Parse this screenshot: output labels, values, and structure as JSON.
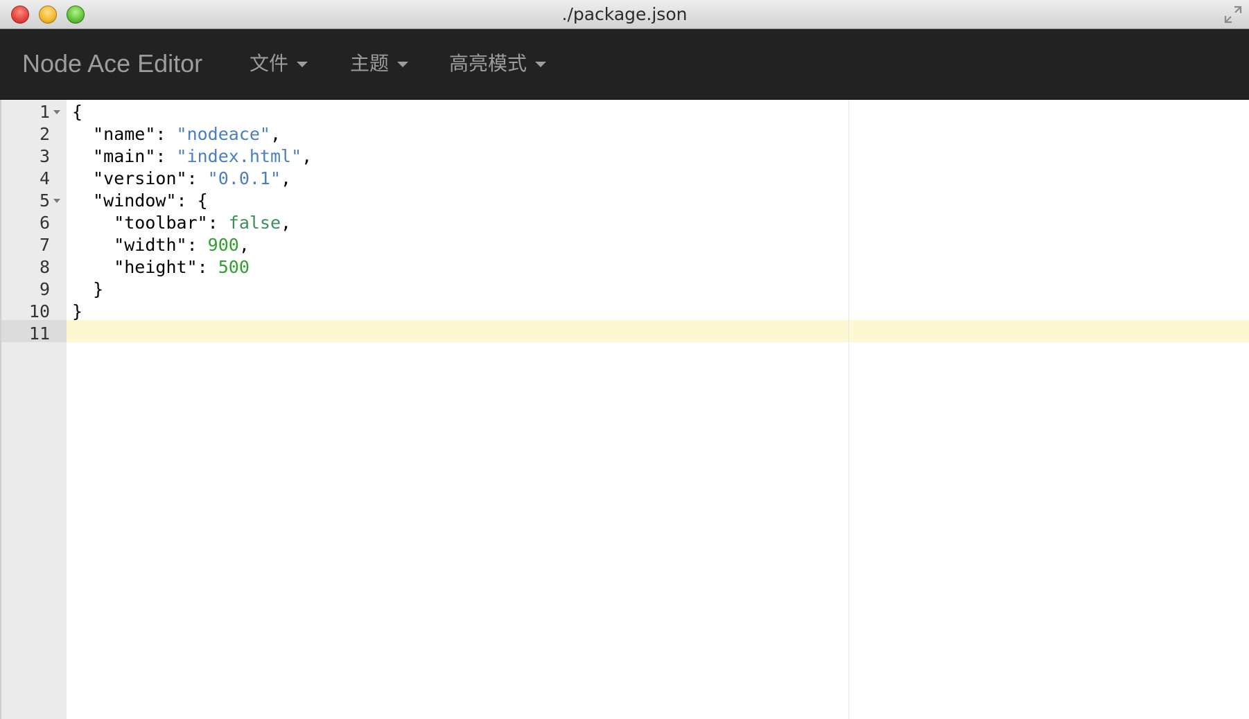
{
  "window": {
    "title": "./package.json"
  },
  "navbar": {
    "brand": "Node Ace Editor",
    "menus": [
      {
        "label": "文件"
      },
      {
        "label": "主题"
      },
      {
        "label": "高亮模式"
      }
    ]
  },
  "editor": {
    "active_line": 11,
    "lines": [
      {
        "num": "1",
        "tokens": [
          {
            "t": "{",
            "c": "plain"
          }
        ]
      },
      {
        "num": "2",
        "tokens": [
          {
            "t": "  \"name\": ",
            "c": "plain"
          },
          {
            "t": "\"nodeace\"",
            "c": "str"
          },
          {
            "t": ",",
            "c": "plain"
          }
        ]
      },
      {
        "num": "3",
        "tokens": [
          {
            "t": "  \"main\": ",
            "c": "plain"
          },
          {
            "t": "\"index.html\"",
            "c": "str"
          },
          {
            "t": ",",
            "c": "plain"
          }
        ]
      },
      {
        "num": "4",
        "tokens": [
          {
            "t": "  \"version\": ",
            "c": "plain"
          },
          {
            "t": "\"0.0.1\"",
            "c": "str"
          },
          {
            "t": ",",
            "c": "plain"
          }
        ]
      },
      {
        "num": "5",
        "tokens": [
          {
            "t": "  \"window\": {",
            "c": "plain"
          }
        ]
      },
      {
        "num": "6",
        "tokens": [
          {
            "t": "    \"toolbar\": ",
            "c": "plain"
          },
          {
            "t": "false",
            "c": "bool"
          },
          {
            "t": ",",
            "c": "plain"
          }
        ]
      },
      {
        "num": "7",
        "tokens": [
          {
            "t": "    \"width\": ",
            "c": "plain"
          },
          {
            "t": "900",
            "c": "num"
          },
          {
            "t": ",",
            "c": "plain"
          }
        ]
      },
      {
        "num": "8",
        "tokens": [
          {
            "t": "    \"height\": ",
            "c": "plain"
          },
          {
            "t": "500",
            "c": "num"
          }
        ]
      },
      {
        "num": "9",
        "tokens": [
          {
            "t": "  }",
            "c": "plain"
          }
        ]
      },
      {
        "num": "10",
        "tokens": [
          {
            "t": "}",
            "c": "plain"
          }
        ]
      },
      {
        "num": "11",
        "tokens": []
      }
    ],
    "foldable_lines": [
      "1",
      "5"
    ]
  },
  "colors": {
    "navbar_bg": "#222222",
    "string": "#4a7fc1",
    "number": "#2fa02f",
    "boolean": "#3c8f5a",
    "active_line_bg": "#fdf8d2"
  }
}
